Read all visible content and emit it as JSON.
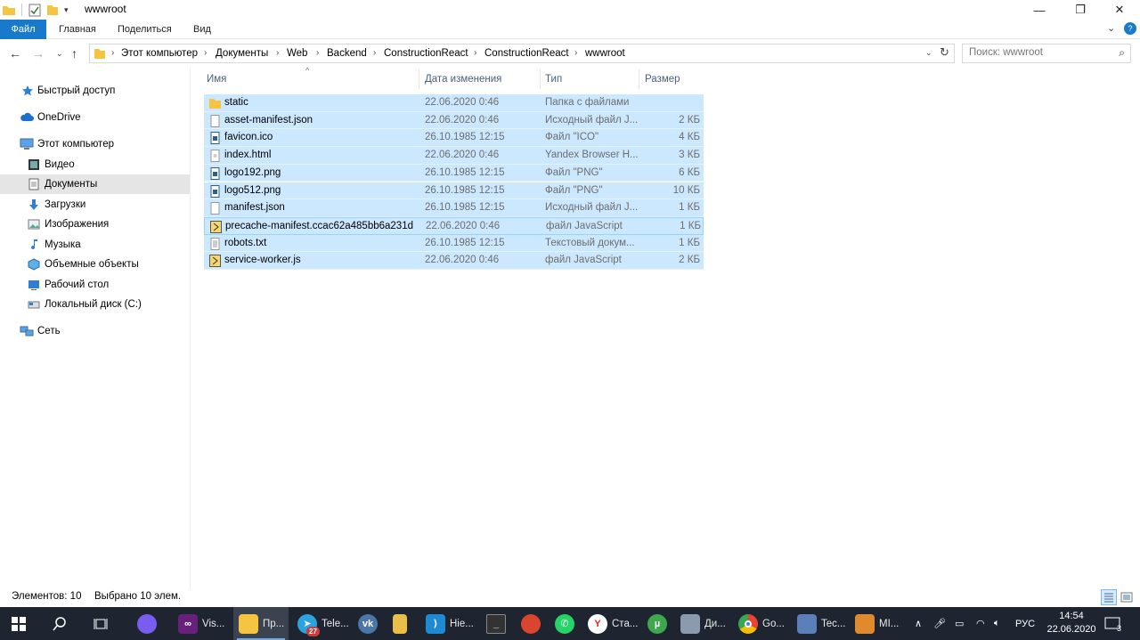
{
  "window": {
    "title": "wwwroot"
  },
  "ribbon": {
    "tabs": [
      "Файл",
      "Главная",
      "Поделиться",
      "Вид"
    ]
  },
  "address": {
    "crumbs": [
      "Этот компьютер",
      "Документы",
      "Web",
      "Backend",
      "ConstructionReact",
      "ConstructionReact",
      "wwwroot"
    ]
  },
  "search": {
    "placeholder": "Поиск: wwwroot"
  },
  "sidebar": {
    "items": [
      {
        "label": "Быстрый доступ",
        "icon": "star-icon"
      },
      {
        "label": "OneDrive",
        "icon": "cloud-icon"
      },
      {
        "label": "Этот компьютер",
        "icon": "computer-icon"
      },
      {
        "label": "Видео",
        "icon": "video-icon"
      },
      {
        "label": "Документы",
        "icon": "documents-icon",
        "selected": true
      },
      {
        "label": "Загрузки",
        "icon": "download-icon"
      },
      {
        "label": "Изображения",
        "icon": "pictures-icon"
      },
      {
        "label": "Музыка",
        "icon": "music-icon"
      },
      {
        "label": "Объемные объекты",
        "icon": "3d-objects-icon"
      },
      {
        "label": "Рабочий стол",
        "icon": "desktop-icon"
      },
      {
        "label": "Локальный диск (C:)",
        "icon": "drive-icon"
      },
      {
        "label": "Сеть",
        "icon": "network-icon"
      }
    ]
  },
  "columns": {
    "name": "Имя",
    "date": "Дата изменения",
    "type": "Тип",
    "size": "Размер"
  },
  "files": [
    {
      "name": "static",
      "date": "22.06.2020 0:46",
      "type": "Папка с файлами",
      "size": "",
      "icon": "folder-icon"
    },
    {
      "name": "asset-manifest.json",
      "date": "22.06.2020 0:46",
      "type": "Исходный файл J...",
      "size": "2 КБ",
      "icon": "file-icon"
    },
    {
      "name": "favicon.ico",
      "date": "26.10.1985 12:15",
      "type": "Файл \"ICO\"",
      "size": "4 КБ",
      "icon": "image-file-icon"
    },
    {
      "name": "index.html",
      "date": "22.06.2020 0:46",
      "type": "Yandex Browser H...",
      "size": "3 КБ",
      "icon": "html-file-icon"
    },
    {
      "name": "logo192.png",
      "date": "26.10.1985 12:15",
      "type": "Файл \"PNG\"",
      "size": "6 КБ",
      "icon": "image-file-icon"
    },
    {
      "name": "logo512.png",
      "date": "26.10.1985 12:15",
      "type": "Файл \"PNG\"",
      "size": "10 КБ",
      "icon": "image-file-icon"
    },
    {
      "name": "manifest.json",
      "date": "26.10.1985 12:15",
      "type": "Исходный файл J...",
      "size": "1 КБ",
      "icon": "file-icon"
    },
    {
      "name": "precache-manifest.ccac62a485bb6a231d...",
      "date": "22.06.2020 0:46",
      "type": "файл JavaScript",
      "size": "1 КБ",
      "icon": "js-file-icon",
      "focused": true
    },
    {
      "name": "robots.txt",
      "date": "26.10.1985 12:15",
      "type": "Текстовый докум...",
      "size": "1 КБ",
      "icon": "text-file-icon"
    },
    {
      "name": "service-worker.js",
      "date": "22.06.2020 0:46",
      "type": "файл JavaScript",
      "size": "2 КБ",
      "icon": "js-file-icon"
    }
  ],
  "status": {
    "count": "Элементов: 10",
    "selected": "Выбрано 10 элем."
  },
  "taskbar": {
    "items": [
      {
        "label": "",
        "icon": "alice-icon",
        "color": "#7b5cf0"
      },
      {
        "label": "Vis...",
        "icon": "visual-studio-icon",
        "color": "#68217a"
      },
      {
        "label": "Пр...",
        "icon": "explorer-icon",
        "color": "#f5c542",
        "active": true
      },
      {
        "label": "Tele...",
        "icon": "telegram-icon",
        "color": "#2aa3df",
        "badge": "27"
      },
      {
        "label": "",
        "icon": "vk-icon",
        "color": "#4a76a8"
      },
      {
        "label": "",
        "icon": "notepad-icon",
        "color": "#e8c048"
      },
      {
        "label": "Hie...",
        "icon": "vscode-icon",
        "color": "#1f8ad2"
      },
      {
        "label": "",
        "icon": "terminal-icon",
        "color": "#333333"
      },
      {
        "label": "",
        "icon": "cleaner-icon",
        "color": "#d9452e"
      },
      {
        "label": "",
        "icon": "whatsapp-icon",
        "color": "#25d366"
      },
      {
        "label": "Ста...",
        "icon": "yandex-browser-icon",
        "color": "#ffffff"
      },
      {
        "label": "",
        "icon": "utorrent-icon",
        "color": "#3fa74d"
      },
      {
        "label": "Ди...",
        "icon": "monitor-icon",
        "color": "#8a9bb0"
      },
      {
        "label": "Go...",
        "icon": "chrome-icon",
        "color": "#4285f4"
      },
      {
        "label": "Tec...",
        "icon": "editor-icon",
        "color": "#5b7fb8"
      },
      {
        "label": "MI...",
        "icon": "mi-icon",
        "color": "#e08a2e"
      }
    ],
    "tray": {
      "lang": "РУС",
      "time": "14:54",
      "date": "22.06.2020",
      "notifications": "3"
    }
  }
}
